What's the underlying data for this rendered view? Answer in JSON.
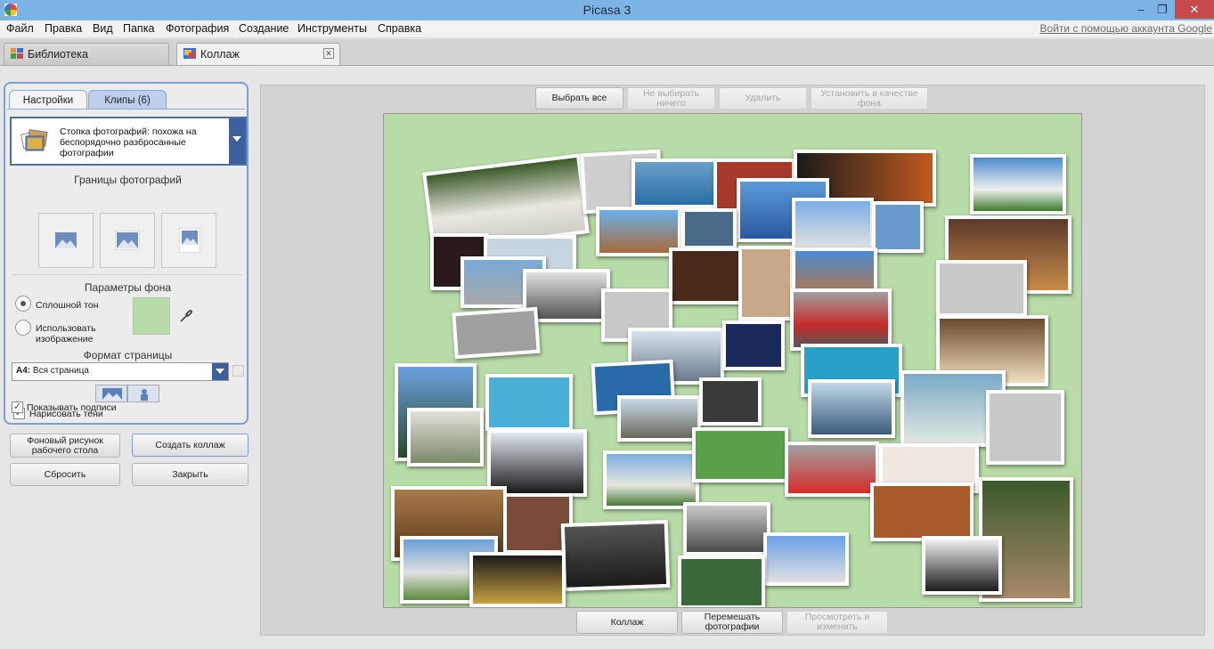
{
  "window": {
    "title": "Picasa 3"
  },
  "menu": {
    "items": [
      "Файл",
      "Правка",
      "Вид",
      "Папка",
      "Фотография",
      "Создание",
      "Инструменты",
      "Справка"
    ],
    "google_link": "Войти с помощью аккаунта Google"
  },
  "tabs": [
    {
      "label": "Библиотека"
    },
    {
      "label": "Коллаж"
    }
  ],
  "panel": {
    "tab_settings": "Настройки",
    "tab_clips": "Клипы (6)",
    "collage_style": "Стопка фотографий: похожа на беспорядочно разбросанные фотографии",
    "borders_title": "Границы фотографий",
    "bg_title": "Параметры фона",
    "solid_label": "Сплошной тон",
    "image_label": "Использовать изображение",
    "format_title": "Формат страницы",
    "format_prefix": "A4:",
    "format_value": "Вся страница",
    "draw_shadows": "Нарисовать тени",
    "show_captions": "Показывать подписи"
  },
  "buttons": {
    "desktop_bg": "Фоновый рисунок рабочего стола",
    "create": "Создать коллаж",
    "reset": "Сбросить",
    "close": "Закрыть"
  },
  "toolbar": {
    "select_all": "Выбрать все",
    "select_none": "Не выбирать ничего",
    "delete": "Удалить",
    "set_bg": "Установить в качестве фона"
  },
  "bottom": {
    "collage": "Коллаж",
    "shuffle": "Перемешать фотографии",
    "view_edit": "Просмотреть и изменить"
  },
  "colors": {
    "canvas_bg": "#b8dca8",
    "accent": "#4a6fb0",
    "titlebar": "#7db4e6"
  }
}
